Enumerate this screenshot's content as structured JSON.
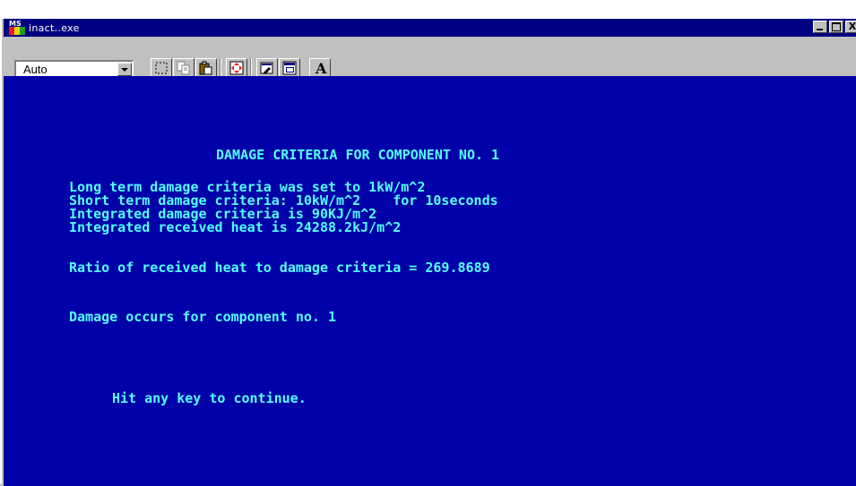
{
  "window": {
    "title": "inact..exe",
    "icon": "ms-dos-icon",
    "close_label": "X"
  },
  "toolbar": {
    "font_size_value": "Auto",
    "bold_font_label": "A",
    "tools": [
      "mark-icon",
      "copy-icon",
      "paste-icon",
      "fullscreen-icon",
      "properties-icon",
      "background-icon",
      "font-icon"
    ]
  },
  "console": {
    "heading": "DAMAGE CRITERIA FOR COMPONENT NO. 1",
    "lines": [
      "Long term damage criteria was set to 1kW/m^2",
      "Short term damage criteria: 10kW/m^2    for 10seconds",
      "Integrated damage criteria is 90KJ/m^2",
      "Integrated received heat is 24288.2kJ/m^2"
    ],
    "ratio_line": "Ratio of received heat to damage criteria = 269.8689",
    "damage_line": "Damage occurs for component no. 1",
    "prompt": "Hit any key to continue."
  },
  "colors": {
    "console_bg": "#0000a8",
    "console_text": "#55ffff",
    "titlebar_bg": "#000080"
  }
}
